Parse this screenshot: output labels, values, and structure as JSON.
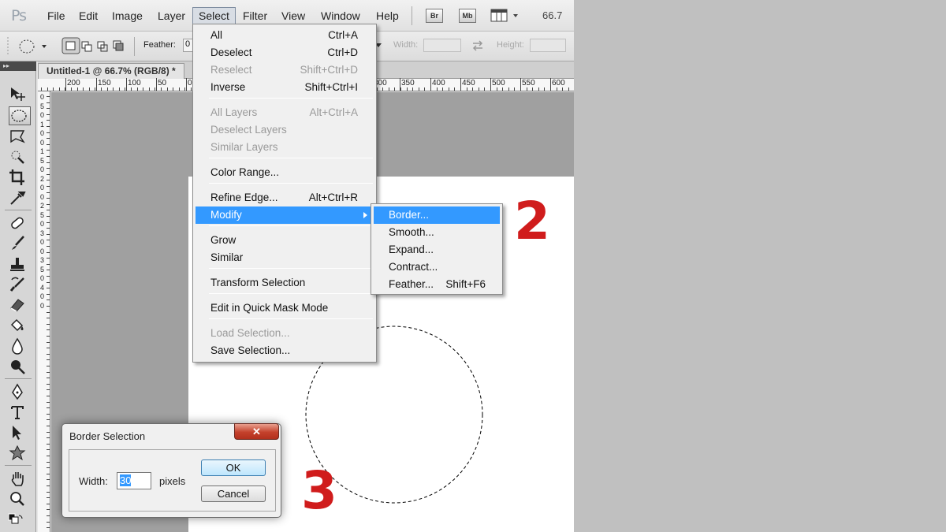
{
  "app": {
    "logo": "Ps"
  },
  "menubar": {
    "items": [
      "File",
      "Edit",
      "Image",
      "Layer",
      "Select",
      "Filter",
      "View",
      "Window",
      "Help"
    ],
    "active": "Select",
    "bridge_label": "Br",
    "minibridge_label": "Mb",
    "zoom": "66.7"
  },
  "options": {
    "feather_label": "Feather:",
    "feather_value": "0",
    "width_label": "Width:",
    "height_label": "Height:"
  },
  "document": {
    "tab_title": "Untitled-1 @ 66.7% (RGB/8) *"
  },
  "ruler_top_labels": [
    "200",
    "150",
    "100",
    "50",
    "0",
    "300",
    "350",
    "400",
    "450",
    "500",
    "550",
    "600"
  ],
  "ruler_left_labels": [
    "0",
    "5",
    "0",
    "1",
    "0",
    "0",
    "1",
    "5",
    "0",
    "2",
    "0",
    "0",
    "2",
    "5",
    "0",
    "3",
    "0",
    "0",
    "3",
    "5",
    "0",
    "4",
    "0",
    "0"
  ],
  "select_menu": {
    "items": [
      {
        "label": "All",
        "shortcut": "Ctrl+A",
        "disabled": false
      },
      {
        "label": "Deselect",
        "shortcut": "Ctrl+D",
        "disabled": false
      },
      {
        "label": "Reselect",
        "shortcut": "Shift+Ctrl+D",
        "disabled": true
      },
      {
        "label": "Inverse",
        "shortcut": "Shift+Ctrl+I",
        "disabled": false
      },
      {
        "label": "All Layers",
        "shortcut": "Alt+Ctrl+A",
        "disabled": true
      },
      {
        "label": "Deselect Layers",
        "shortcut": "",
        "disabled": true
      },
      {
        "label": "Similar Layers",
        "shortcut": "",
        "disabled": true
      },
      {
        "label": "Color Range...",
        "shortcut": "",
        "disabled": false
      },
      {
        "label": "Refine Edge...",
        "shortcut": "Alt+Ctrl+R",
        "disabled": false
      },
      {
        "label": "Modify",
        "shortcut": "",
        "disabled": false,
        "highlighted": true,
        "submenu": true
      },
      {
        "label": "Grow",
        "shortcut": "",
        "disabled": false
      },
      {
        "label": "Similar",
        "shortcut": "",
        "disabled": false
      },
      {
        "label": "Transform Selection",
        "shortcut": "",
        "disabled": false
      },
      {
        "label": "Edit in Quick Mask Mode",
        "shortcut": "",
        "disabled": false
      },
      {
        "label": "Load Selection...",
        "shortcut": "",
        "disabled": true
      },
      {
        "label": "Save Selection...",
        "shortcut": "",
        "disabled": false
      }
    ]
  },
  "modify_menu": {
    "items": [
      {
        "label": "Border...",
        "shortcut": "",
        "highlighted": true
      },
      {
        "label": "Smooth...",
        "shortcut": ""
      },
      {
        "label": "Expand...",
        "shortcut": ""
      },
      {
        "label": "Contract...",
        "shortcut": ""
      },
      {
        "label": "Feather...",
        "shortcut": "Shift+F6"
      }
    ]
  },
  "annotations": {
    "step2": "2",
    "step3": "3"
  },
  "dialog": {
    "title": "Border Selection",
    "close": "✕",
    "width_label": "Width:",
    "width_value": "30",
    "unit": "pixels",
    "ok": "OK",
    "cancel": "Cancel"
  },
  "colors": {
    "highlight": "#3399ff",
    "annotation": "#d01c1c",
    "close_button": "#c4412c"
  }
}
